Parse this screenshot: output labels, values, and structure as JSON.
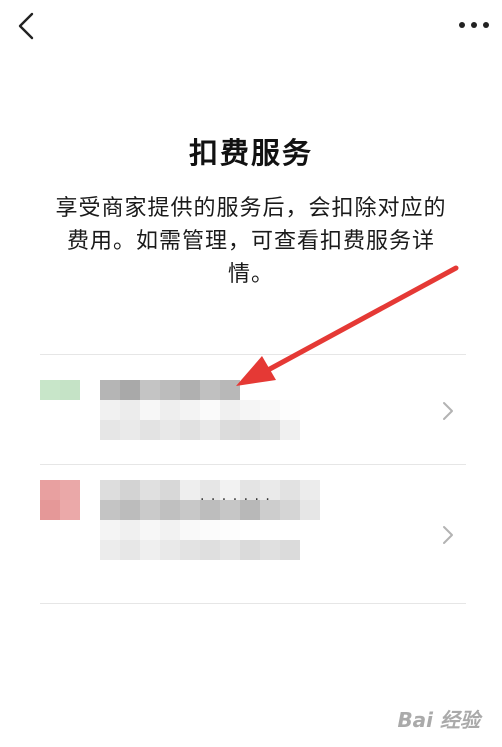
{
  "header": {
    "back_icon": "chevron-left-icon",
    "more_icon": "more-dots-icon"
  },
  "page": {
    "title": "扣费服务",
    "description": "享受商家提供的服务后，会扣除对应的费用。如需管理，可查看扣费服务详情。"
  },
  "services": [
    {
      "logo_color": "#c8e6c9",
      "name_blurred": true,
      "chevron_icon": "chevron-right-icon"
    },
    {
      "logo_color": "#e8a0a0",
      "name_blurred": true,
      "extra_text": "· · · · · · ·",
      "chevron_icon": "chevron-right-icon"
    }
  ],
  "annotation": {
    "arrow_color": "#e53935"
  },
  "watermark": {
    "text": "Bai 经验"
  }
}
